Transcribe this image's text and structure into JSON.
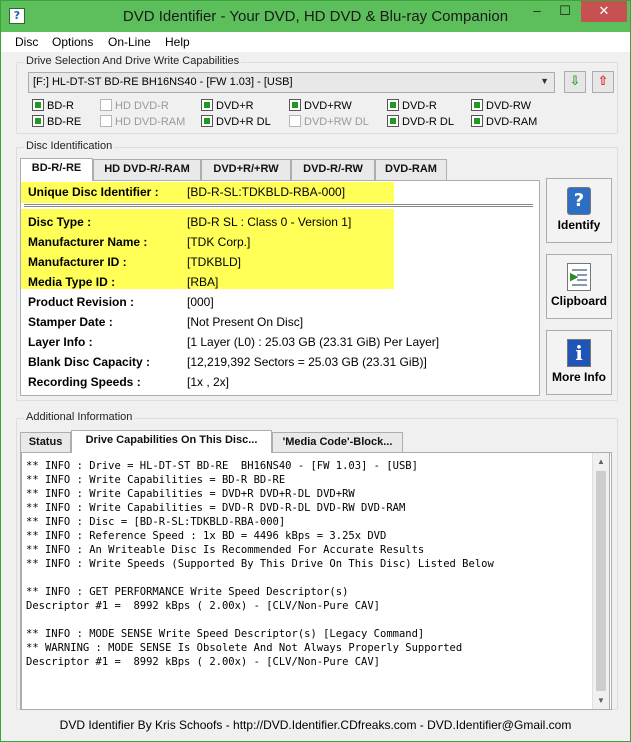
{
  "window": {
    "title": "DVD Identifier - Your DVD, HD DVD & Blu-ray Companion",
    "icon": "disc-question-icon",
    "minimize": "–",
    "maximize": "☐",
    "close": "✕"
  },
  "menu": [
    "Disc",
    "Options",
    "On-Line",
    "Help"
  ],
  "drive_section": {
    "label": "Drive Selection And Drive Write Capabilities",
    "selected_drive": "[F:] HL-DT-ST BD-RE  BH16NS40 - [FW 1.03] - [USB]",
    "eject_glyph": "⇩",
    "load_glyph": "⇧",
    "capabilities": [
      {
        "label": "BD-R",
        "checked": true,
        "enabled": true
      },
      {
        "label": "BD-RE",
        "checked": true,
        "enabled": true
      },
      {
        "label": "HD DVD-R",
        "checked": false,
        "enabled": false
      },
      {
        "label": "HD DVD-RAM",
        "checked": false,
        "enabled": false
      },
      {
        "label": "DVD+R",
        "checked": true,
        "enabled": true
      },
      {
        "label": "DVD+R DL",
        "checked": true,
        "enabled": true
      },
      {
        "label": "DVD+RW",
        "checked": true,
        "enabled": true
      },
      {
        "label": "DVD+RW DL",
        "checked": false,
        "enabled": false
      },
      {
        "label": "DVD-R",
        "checked": true,
        "enabled": true
      },
      {
        "label": "DVD-R DL",
        "checked": true,
        "enabled": true
      },
      {
        "label": "DVD-RW",
        "checked": true,
        "enabled": true
      },
      {
        "label": "DVD-RAM",
        "checked": true,
        "enabled": true
      }
    ]
  },
  "disc_identification": {
    "label": "Disc Identification",
    "tabs": [
      "BD-R/-RE",
      "HD DVD-R/-RAM",
      "DVD+R/+RW",
      "DVD-R/-RW",
      "DVD-RAM"
    ],
    "active_tab": "BD-R/-RE",
    "unique_id": {
      "label": "Unique Disc Identifier :",
      "value": "[BD-R-SL:TDKBLD-RBA-000]"
    },
    "fields": [
      {
        "label": "Disc Type :",
        "value": "[BD-R SL : Class 0 - Version 1]"
      },
      {
        "label": "Manufacturer Name :",
        "value": "[TDK Corp.]"
      },
      {
        "label": "Manufacturer ID :",
        "value": "[TDKBLD]"
      },
      {
        "label": "Media Type ID :",
        "value": "[RBA]"
      },
      {
        "label": "Product Revision :",
        "value": "[000]"
      },
      {
        "label": "Stamper Date :",
        "value": "[Not Present On Disc]"
      },
      {
        "label": "Layer Info :",
        "value": "[1 Layer (L0) : 25.03 GB (23.31 GiB) Per Layer]"
      },
      {
        "label": "Blank Disc Capacity :",
        "value": "[12,219,392 Sectors = 25.03 GB (23.31 GiB)]"
      },
      {
        "label": "Recording Speeds :",
        "value": "[1x , 2x]"
      }
    ],
    "highlight_color": "#ffff57"
  },
  "side_buttons": [
    {
      "label": "Identify",
      "icon": "identify-question-icon"
    },
    {
      "label": "Clipboard",
      "icon": "clipboard-icon"
    },
    {
      "label": "More Info",
      "icon": "info-icon"
    }
  ],
  "additional": {
    "label": "Additional Information",
    "tabs": [
      "Status",
      "Drive Capabilities On This Disc...",
      "'Media Code'-Block..."
    ],
    "active_tab": "Drive Capabilities On This Disc...",
    "log": [
      "** INFO : Drive = HL-DT-ST BD-RE  BH16NS40 - [FW 1.03] - [USB]",
      "** INFO : Write Capabilities = BD-R BD-RE",
      "** INFO : Write Capabilities = DVD+R DVD+R-DL DVD+RW",
      "** INFO : Write Capabilities = DVD-R DVD-R-DL DVD-RW DVD-RAM",
      "** INFO : Disc = [BD-R-SL:TDKBLD-RBA-000]",
      "** INFO : Reference Speed : 1x BD = 4496 kBps = 3.25x DVD",
      "** INFO : An Writeable Disc Is Recommended For Accurate Results",
      "** INFO : Write Speeds (Supported By This Drive On This Disc) Listed Below",
      "",
      "** INFO : GET PERFORMANCE Write Speed Descriptor(s)",
      "Descriptor #1 =  8992 kBps ( 2.00x) - [CLV/Non-Pure CAV]",
      "",
      "** INFO : MODE SENSE Write Speed Descriptor(s) [Legacy Command]",
      "** WARNING : MODE SENSE Is Obsolete And Not Always Properly Supported",
      "Descriptor #1 =  8992 kBps ( 2.00x) - [CLV/Non-Pure CAV]"
    ]
  },
  "statusbar": "DVD Identifier By Kris Schoofs  -  http://DVD.Identifier.CDfreaks.com  -  DVD.Identifier@Gmail.com"
}
